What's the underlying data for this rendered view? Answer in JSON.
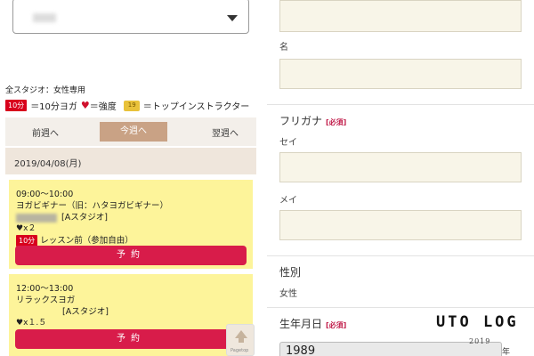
{
  "left": {
    "studio_select": {
      "value": ""
    },
    "note": "全スタジオ：女性専用",
    "legend": {
      "badge_10": "10分",
      "badge_10_text": "＝10分ヨガ",
      "heart_icon": "♥",
      "heart_text": "＝強度",
      "crown_text": "＝トップインストラクター"
    },
    "week_nav": {
      "prev": "前週へ",
      "current": "今週へ",
      "next": "翌週へ"
    },
    "date": "2019/04/08(月)",
    "lessons": [
      {
        "time": "09:00〜10:00",
        "name": "ヨガビギナー（旧：ハタヨガビギナー）",
        "studio": "[Aスタジオ]",
        "intensity_icon": "♥",
        "intensity": "x２",
        "tag": "10分",
        "tag_text": "レッスン前（参加自由）",
        "reserve_label": "予約"
      },
      {
        "time": "12:00〜13:00",
        "name": "リラックスヨガ",
        "studio": "[Aスタジオ]",
        "intensity_icon": "♥",
        "intensity": "x１.５",
        "reserve_label": "予約"
      }
    ],
    "pagetop_label": "Pagetop"
  },
  "right": {
    "label_mei_first": "名",
    "furigana_title": "フリガナ",
    "required": "[必須]",
    "sei_label": "セイ",
    "mei_label": "メイ",
    "gender_title": "性別",
    "gender_value": "女性",
    "birthdate_title": "生年月日",
    "birth_year": "1989",
    "year_unit": "年"
  },
  "watermark": {
    "title": "UTO LOG",
    "sub": "2019"
  }
}
